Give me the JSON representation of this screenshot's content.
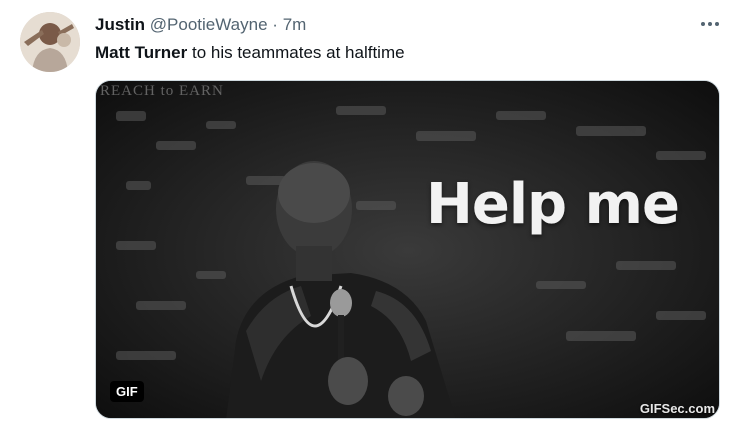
{
  "tweet": {
    "author_name": "Justin",
    "handle": "@PootieWayne",
    "separator": "·",
    "time": "7m",
    "mention": "Matt Turner",
    "text": " to his teammates at halftime",
    "more_icon": "more-horizontal-icon"
  },
  "media": {
    "caption_text": "Help me",
    "badge": "GIF",
    "watermark": "GIFSec.com",
    "background_text": "REACH to EARN"
  }
}
